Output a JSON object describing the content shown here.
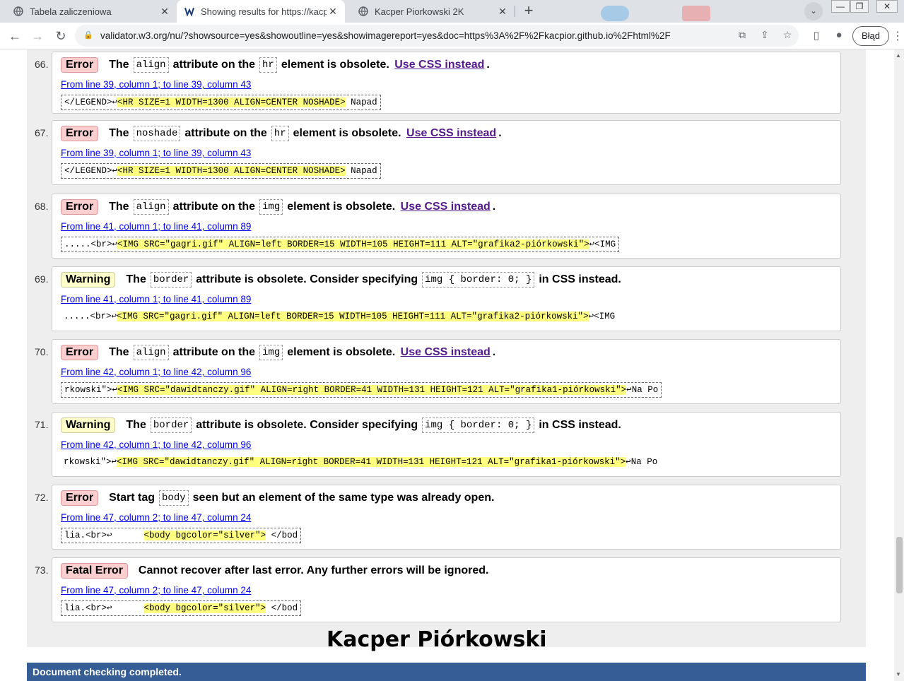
{
  "tabs": [
    {
      "label": "Tabela zaliczeniowa",
      "icon": "globe-icon"
    },
    {
      "label": "Showing results for https://kacpior",
      "icon": "w3c-icon"
    },
    {
      "label": "Kacper Piorkowski 2K",
      "icon": "globe-icon"
    }
  ],
  "omnibox": {
    "url": "validator.w3.org/nu/?showsource=yes&showoutline=yes&showimagereport=yes&doc=https%3A%2F%2Fkacpior.github.io%2Fhtml%2F"
  },
  "toolbar": {
    "error_label": "Błąd"
  },
  "messages": [
    {
      "num": "66.",
      "badge": "Error",
      "type": "error",
      "pre": "The",
      "code1": "align",
      "mid": "attribute on the",
      "code2": "hr",
      "post": "element is obsolete.",
      "link": "Use CSS instead",
      "location": "From line 39, column 1; to line 39, column 43",
      "ext_pre": "</LEGEND>↩",
      "ext_hl": "<HR SIZE=1 WIDTH=1300 ALIGN=CENTER NOSHADE>",
      "ext_post": " Napad"
    },
    {
      "num": "67.",
      "badge": "Error",
      "type": "error",
      "pre": "The",
      "code1": "noshade",
      "mid": "attribute on the",
      "code2": "hr",
      "post": "element is obsolete.",
      "link": "Use CSS instead",
      "location": "From line 39, column 1; to line 39, column 43",
      "ext_pre": "</LEGEND>↩",
      "ext_hl": "<HR SIZE=1 WIDTH=1300 ALIGN=CENTER NOSHADE>",
      "ext_post": " Napad"
    },
    {
      "num": "68.",
      "badge": "Error",
      "type": "error",
      "pre": "The",
      "code1": "align",
      "mid": "attribute on the",
      "code2": "img",
      "post": "element is obsolete.",
      "link": "Use CSS instead",
      "location": "From line 41, column 1; to line 41, column 89",
      "ext_pre": ".....<br>↩",
      "ext_hl": "<IMG SRC=\"gagri.gif\" ALIGN=left BORDER=15 WIDTH=105 HEIGHT=111 ALT=\"grafika2-piórkowski\">",
      "ext_post": "↩<IMG"
    },
    {
      "num": "69.",
      "badge": "Warning",
      "type": "warn",
      "pre": "The",
      "code1": "border",
      "mid": "attribute is obsolete. Consider specifying",
      "code2": "img { border: 0; }",
      "post": "in CSS instead.",
      "link": "",
      "location": "From line 41, column 1; to line 41, column 89",
      "ext_pre": ".....<br>↩",
      "ext_hl": "<IMG SRC=\"gagri.gif\" ALIGN=left BORDER=15 WIDTH=105 HEIGHT=111 ALT=\"grafika2-piórkowski\">",
      "ext_post": "↩<IMG"
    },
    {
      "num": "70.",
      "badge": "Error",
      "type": "error",
      "pre": "The",
      "code1": "align",
      "mid": "attribute on the",
      "code2": "img",
      "post": "element is obsolete.",
      "link": "Use CSS instead",
      "location": "From line 42, column 1; to line 42, column 96",
      "ext_pre": "rkowski\">↩",
      "ext_hl": "<IMG SRC=\"dawidtanczy.gif\" ALIGN=right BORDER=41 WIDTH=131 HEIGHT=121 ALT=\"grafika1-piórkowski\">",
      "ext_post": "↩Na Po"
    },
    {
      "num": "71.",
      "badge": "Warning",
      "type": "warn",
      "pre": "The",
      "code1": "border",
      "mid": "attribute is obsolete. Consider specifying",
      "code2": "img { border: 0; }",
      "post": "in CSS instead.",
      "link": "",
      "location": "From line 42, column 1; to line 42, column 96",
      "ext_pre": "rkowski\">↩",
      "ext_hl": "<IMG SRC=\"dawidtanczy.gif\" ALIGN=right BORDER=41 WIDTH=131 HEIGHT=121 ALT=\"grafika1-piórkowski\">",
      "ext_post": "↩Na Po"
    },
    {
      "num": "72.",
      "badge": "Error",
      "type": "error",
      "pre": "Start tag",
      "code1": "body",
      "mid": "seen but an element of the same type was already open.",
      "code2": "",
      "post": "",
      "link": "",
      "location": "From line 47, column 2; to line 47, column 24",
      "ext_pre": "lia.<br>↩      ",
      "ext_hl": "<body bgcolor=\"silver\">",
      "ext_post": " </bod"
    },
    {
      "num": "73.",
      "badge": "Fatal Error",
      "type": "error",
      "pre": "Cannot recover after last error. Any further errors will be ignored.",
      "code1": "",
      "mid": "",
      "code2": "",
      "post": "",
      "link": "",
      "location": "From line 47, column 2; to line 47, column 24",
      "ext_pre": "lia.<br>↩      ",
      "ext_hl": "<body bgcolor=\"silver\">",
      "ext_post": " </bod"
    }
  ],
  "footer_name": "Kacper Piórkowski",
  "status": "Document checking completed."
}
